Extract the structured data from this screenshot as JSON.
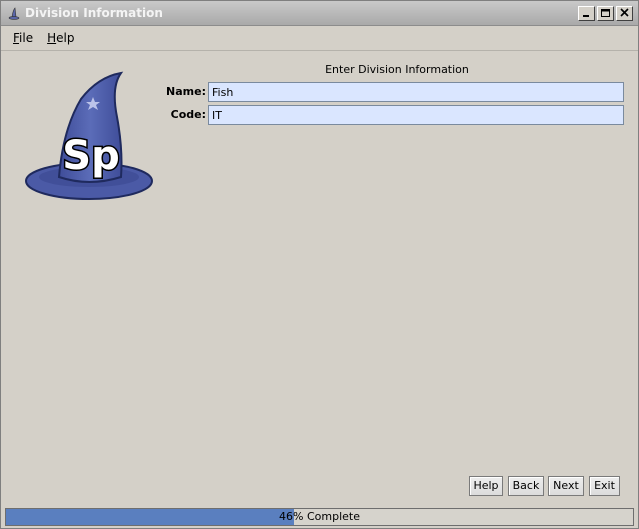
{
  "window": {
    "title": "Division Information"
  },
  "menu": {
    "items": [
      {
        "label": "File",
        "mnemonic": "F"
      },
      {
        "label": "Help",
        "mnemonic": "H"
      }
    ]
  },
  "logo": {
    "icon": "wizard-hat-icon",
    "text": "Sp",
    "color": "#4f5ea8"
  },
  "form": {
    "heading": "Enter Division Information",
    "fields": [
      {
        "label": "Name:",
        "value": "Fish"
      },
      {
        "label": "Code:",
        "value": "IT"
      }
    ]
  },
  "buttons": {
    "help": "Help",
    "back": "Back",
    "next": "Next",
    "exit": "Exit"
  },
  "progress": {
    "value": 46,
    "label": "46% Complete",
    "color": "#5a7fbf"
  }
}
